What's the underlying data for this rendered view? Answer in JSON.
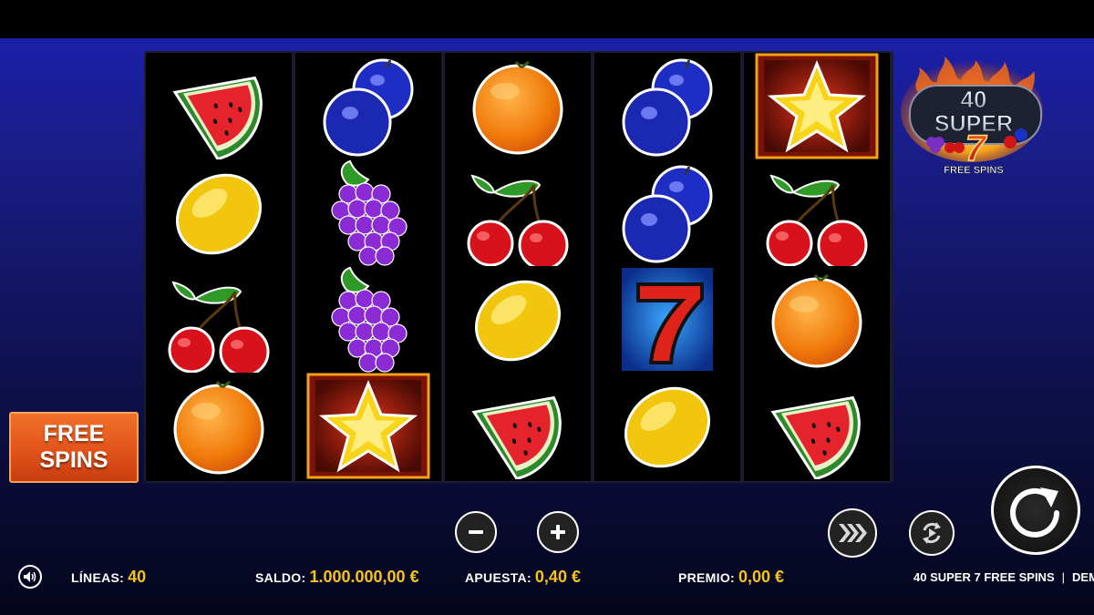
{
  "game": {
    "title_line1": "40",
    "title_line2": "SUPER",
    "title_seven": "7",
    "title_line3": "FREE SPINS"
  },
  "reels": [
    [
      "watermelon",
      "lemon",
      "cherries",
      "orange"
    ],
    [
      "plum",
      "grapes",
      "grapes",
      "star"
    ],
    [
      "orange",
      "cherries",
      "lemon",
      "watermelon"
    ],
    [
      "plum",
      "plum",
      "seven",
      "lemon"
    ],
    [
      "star",
      "cherries",
      "orange",
      "watermelon"
    ]
  ],
  "buttons": {
    "free_spins_line1": "FREE",
    "free_spins_line2": "SPINS",
    "minus": "−",
    "plus": "+"
  },
  "status": {
    "lines_label": "LÍNEAS:",
    "lines_value": "40",
    "balance_label": "SALDO:",
    "balance_value": "1.000.000,00 €",
    "bet_label": "APUESTA:",
    "bet_value": "0,40 €",
    "prize_label": "PREMIO:",
    "prize_value": "0,00 €",
    "game_name": "40 SUPER 7 FREE SPINS",
    "mode": "DEMO"
  },
  "colors": {
    "accent_yellow": "#f5c320",
    "free_spins_orange": "#e2531a"
  }
}
